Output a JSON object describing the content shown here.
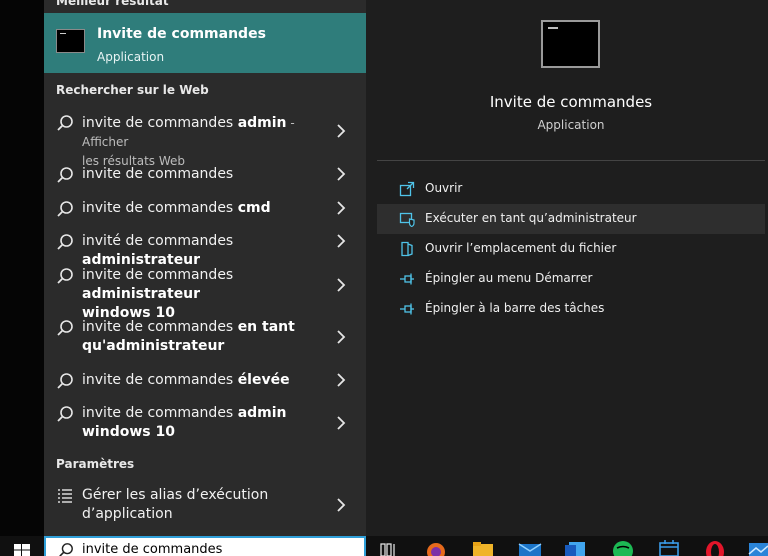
{
  "sections": {
    "best_match": "Meilleur résultat",
    "web": "Rechercher sur le Web",
    "settings": "Paramètres"
  },
  "best_result": {
    "title": "Invite de commandes",
    "subtitle": "Application"
  },
  "web_results": [
    {
      "plain": "invite de commandes ",
      "bold": "admin",
      "suffix": " - Afficher",
      "line2": "les résultats Web"
    },
    {
      "plain": "invite de commandes",
      "bold": "",
      "suffix": "",
      "line2": ""
    },
    {
      "plain": "invite de commandes ",
      "bold": "cmd",
      "suffix": "",
      "line2": ""
    },
    {
      "plain": "invité de commandes ",
      "bold": "administrateur",
      "suffix": "",
      "line2": ""
    },
    {
      "plain": "invite de commandes ",
      "bold": "administrateur",
      "suffix": "",
      "line2": "windows 10"
    },
    {
      "plain": "invite de commandes ",
      "bold": "en tant",
      "suffix": "",
      "line2": "qu'administrateur"
    },
    {
      "plain": "invite de commandes ",
      "bold": "élevée",
      "suffix": "",
      "line2": ""
    },
    {
      "plain": "invite de commandes ",
      "bold": "admin",
      "suffix": "",
      "line2": "windows 10"
    }
  ],
  "settings_result": {
    "line1": "Gérer les alias d’exécution",
    "line2": "d’application"
  },
  "preview": {
    "title": "Invite de commandes",
    "subtitle": "Application"
  },
  "actions": [
    {
      "label": "Ouvrir",
      "icon": "open-icon"
    },
    {
      "label": "Exécuter en tant qu’administrateur",
      "icon": "shield-icon"
    },
    {
      "label": "Ouvrir l’emplacement du fichier",
      "icon": "folder-icon"
    },
    {
      "label": "Épingler au menu Démarrer",
      "icon": "pin-icon"
    },
    {
      "label": "Épingler à la barre des tâches",
      "icon": "pin-icon"
    }
  ],
  "search": {
    "value": "invite de commandes"
  },
  "colors": {
    "best_match_bg": "#2f7d7b",
    "accent_icon": "#4fc3e8",
    "search_border": "#2f9fd8"
  }
}
